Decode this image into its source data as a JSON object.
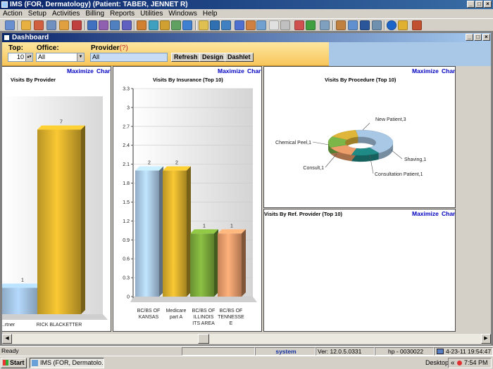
{
  "window": {
    "title": "IMS (FOR, Dermatology)   (Patient: TABER, JENNET R)",
    "min": "_",
    "max": "□",
    "close": "×"
  },
  "menu": [
    "Action",
    "Setup",
    "Activities",
    "Billing",
    "Reports",
    "Utilities",
    "Windows",
    "Help"
  ],
  "dashboard": {
    "title": "Dashboard",
    "filters": {
      "top_label": "Top:",
      "top_value": "10",
      "office_label": "Office:",
      "office_value": "All",
      "provider_label": "Provider",
      "provider_hint": "(?)",
      "provider_value": "All"
    },
    "buttons": {
      "refresh": "Refresh",
      "design": "Design",
      "dashlet": "Dashlet"
    }
  },
  "panels": {
    "provider": {
      "title": "Visits By Provider",
      "maximize": "Maximize",
      "chart": "Chart"
    },
    "insurance": {
      "title": "Visits By Insurance  (Top 10)",
      "maximize": "Maximize",
      "chart": "Chart"
    },
    "procedure": {
      "title": "Visits By Procedure  (Top 10)",
      "maximize": "Maximize",
      "chart": "Chart"
    },
    "ref_provider": {
      "title": "Visits By Ref. Provider (Top 10)",
      "maximize": "Maximize",
      "chart": "Chart"
    }
  },
  "chart_data": [
    {
      "type": "bar",
      "title": "Visits By Provider",
      "categories": [
        "...rtner",
        "RICK BLACKETTER"
      ],
      "values": [
        1,
        7
      ],
      "colors": [
        "#9dbddb",
        "#d9ae2c"
      ]
    },
    {
      "type": "bar",
      "title": "Visits By Insurance  (Top 10)",
      "categories": [
        "BC/BS OF KANSAS",
        "Medicare part A",
        "BC/BS OF ILLINOIS ITS AREA",
        "BC/BS OF TENNESSEE"
      ],
      "category_lines": [
        [
          "BC/BS OF",
          "KANSAS"
        ],
        [
          "Medicare",
          "part A"
        ],
        [
          "BC/BS OF",
          "ILLINOIS",
          "ITS AREA"
        ],
        [
          "BC/BS OF",
          "TENNESSE",
          "E"
        ]
      ],
      "values": [
        2,
        2,
        1,
        1
      ],
      "colors": [
        "#a9c8e6",
        "#d9ae2c",
        "#7aa83a",
        "#e89a6a"
      ],
      "ylim": [
        0,
        3.3
      ],
      "yticks": [
        "0",
        "0.3",
        "0.6",
        "0.9",
        "1.2",
        "1.5",
        "1.8",
        "2.1",
        "2.4",
        "2.7",
        "3",
        "3.3"
      ]
    },
    {
      "type": "pie",
      "title": "Visits By Procedure  (Top 10)",
      "slices": [
        {
          "label": "New Patient,3",
          "value": 3,
          "color": "#a8c8e6"
        },
        {
          "label": "Shaving,1",
          "value": 1,
          "color": "#1f8a86"
        },
        {
          "label": "Consultation Patient,1",
          "value": 1,
          "color": "#ee9e6a"
        },
        {
          "label": "Consult,1",
          "value": 1,
          "color": "#7ab648"
        },
        {
          "label": "Chemical Peel,1",
          "value": 1,
          "color": "#e0b63a"
        }
      ]
    }
  ],
  "status": {
    "ready": "Ready",
    "user": "system",
    "version": "Ver: 12.0.5.0331",
    "host": "hp - 0030022",
    "datetime": "4-23-11 19:54:47"
  },
  "taskbar": {
    "start": "Start",
    "item": "IMS (FOR, Dermatolo...",
    "desktop": "Desktop",
    "arrows": "«",
    "clock": "7:54 PM"
  }
}
